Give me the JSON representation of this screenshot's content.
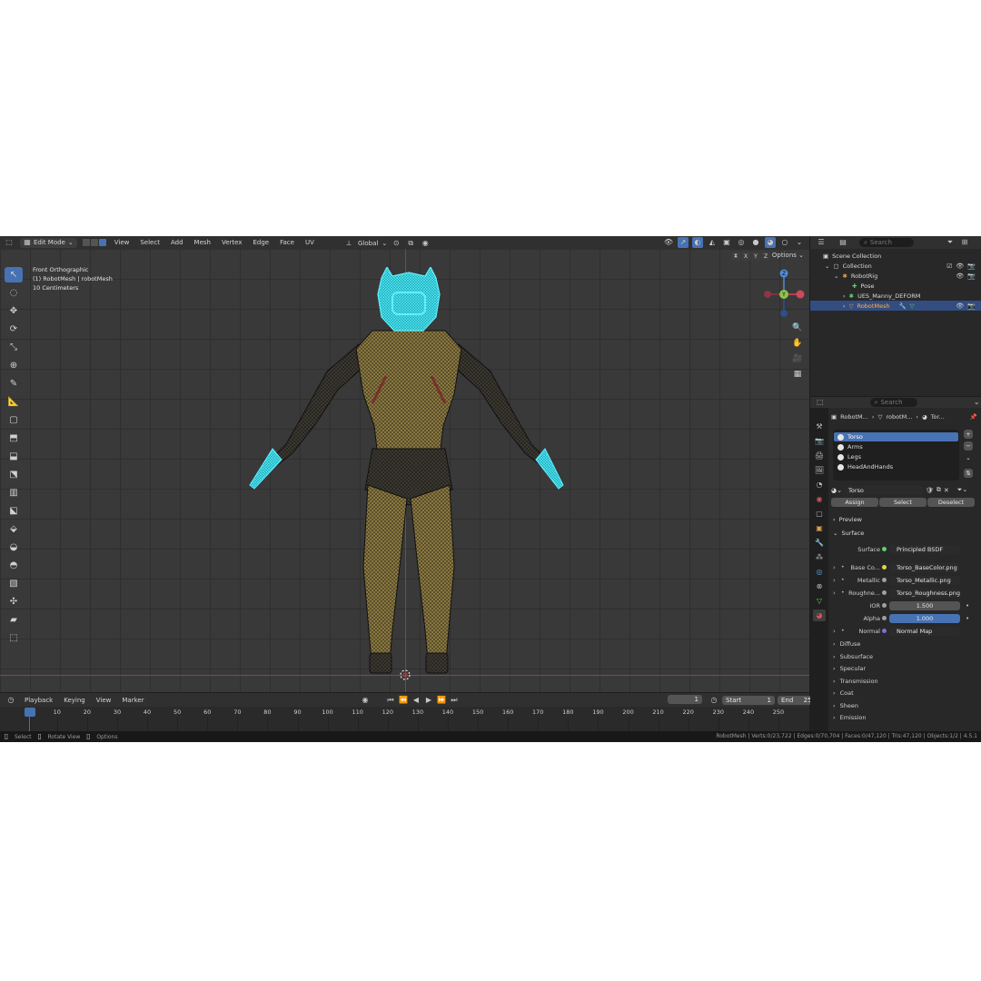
{
  "colors": {
    "accent": "#4772b3",
    "selection": "#334d80",
    "mesh_selected": "#21d9e6",
    "mesh_yellow": "#8c7a42",
    "x_axis": "#a33b3b"
  },
  "header": {
    "mode": "Edit Mode",
    "menus": [
      "View",
      "Select",
      "Add",
      "Mesh",
      "Vertex",
      "Edge",
      "Face",
      "UV"
    ],
    "orientation": "Global",
    "options": "Options"
  },
  "viewport": {
    "view_name": "Front Orthographic",
    "object_line": "(1) RobotMesh | robotMesh",
    "scale": "10 Centimeters",
    "axes": [
      "X",
      "Y",
      "Z"
    ],
    "gizmo": {
      "y": "Y",
      "z": "Z"
    }
  },
  "toolbar": {
    "tools": [
      "select-box",
      "cursor",
      "move",
      "rotate",
      "scale",
      "transform",
      "annotate",
      "measure",
      "add-cube",
      "extrude",
      "inset",
      "bevel",
      "loop-cut",
      "knife",
      "poly-build",
      "spin",
      "smooth",
      "edge-slide",
      "shrink-fatten",
      "shear",
      "rip"
    ]
  },
  "timeline": {
    "menus": [
      "Playback",
      "Keying",
      "View",
      "Marker"
    ],
    "current_frame": "1",
    "start_label": "Start",
    "start": "1",
    "end_label": "End",
    "end": "250",
    "ticks": [
      "1",
      "10",
      "20",
      "30",
      "40",
      "50",
      "60",
      "70",
      "80",
      "90",
      "100",
      "110",
      "120",
      "130",
      "140",
      "150",
      "160",
      "170",
      "180",
      "190",
      "200",
      "210",
      "220",
      "230",
      "240",
      "250"
    ]
  },
  "statusbar": {
    "select": "Select",
    "rotate": "Rotate View",
    "options": "Options",
    "stats": "RobotMesh | Verts:0/23,722 | Edges:0/70,704 | Faces:0/47,120 | Tris:47,120 | Objects:1/2 | 4.5.1"
  },
  "outliner": {
    "search_placeholder": "Search",
    "items": [
      {
        "label": "Scene Collection"
      },
      {
        "label": "Collection"
      },
      {
        "label": "RobotRig"
      },
      {
        "label": "Pose"
      },
      {
        "label": "UES_Manny_DEFORM"
      },
      {
        "label": "RobotMesh"
      }
    ]
  },
  "properties": {
    "search_placeholder": "Search",
    "breadcrumb": [
      "RobotM...",
      "robotM...",
      "Tor..."
    ],
    "slots": [
      "Torso",
      "Arms",
      "Legs",
      "HeadAndHands"
    ],
    "material_name": "Torso",
    "buttons": {
      "assign": "Assign",
      "select": "Select",
      "deselect": "Deselect"
    },
    "panels": {
      "preview": "Preview",
      "surface": "Surface"
    },
    "surface_label": "Surface",
    "surface_value": "Principled BSDF",
    "inputs": [
      {
        "label": "Base Co...",
        "value": "Torso_BaseColor.png"
      },
      {
        "label": "Metallic",
        "value": "Torso_Metallic.png"
      },
      {
        "label": "Roughne...",
        "value": "Torso_Roughness.png"
      },
      {
        "label": "IOR",
        "value": "1.500"
      },
      {
        "label": "Alpha",
        "value": "1.000"
      },
      {
        "label": "Normal",
        "value": "Normal Map"
      }
    ],
    "subpanels": [
      "Diffuse",
      "Subsurface",
      "Specular",
      "Transmission",
      "Coat",
      "Sheen",
      "Emission"
    ]
  }
}
